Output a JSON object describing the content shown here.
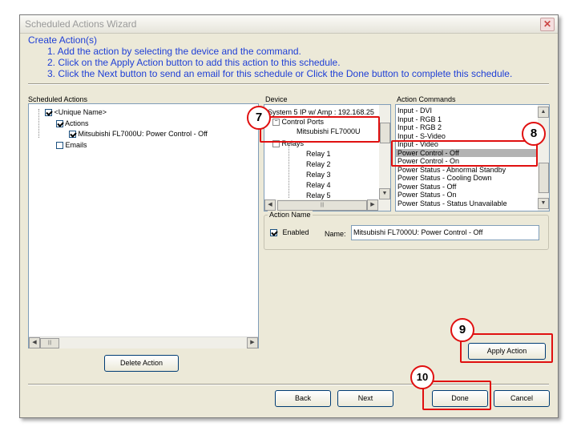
{
  "window": {
    "title": "Scheduled Actions Wizard",
    "close_glyph": "✕"
  },
  "instructions": {
    "heading": "Create Action(s)",
    "steps": [
      "1.   Add the action by selecting the device and the command.",
      "2.   Click on the Apply Action button to add this action to this schedule.",
      "3.   Click the Next button to send an email for this schedule or Click the Done button to complete this schedule."
    ]
  },
  "scheduled_actions": {
    "label": "Scheduled Actions",
    "tree": {
      "root": "<Unique Name>",
      "actions": "Actions",
      "action_item": "Mitsubishi FL7000U: Power Control - Off",
      "emails": "Emails"
    },
    "scroll_thumb_glyph": "|||",
    "delete_button": "Delete Action"
  },
  "device": {
    "label": "Device",
    "items": {
      "system": "System 5 IP w/ Amp : 192.168.25",
      "control_ports": "Control Ports",
      "mitsubishi": "Mitsubishi FL7000U",
      "relays": "Relays",
      "relay_list": [
        "Relay 1",
        "Relay 2",
        "Relay 3",
        "Relay 4",
        "Relay 5"
      ]
    },
    "scroll_thumb_glyph": "|||"
  },
  "action_commands": {
    "label": "Action Commands",
    "items": [
      "Input - DVI",
      "Input - RGB 1",
      "Input - RGB 2",
      "Input - S-Video",
      "Input - Video",
      "Power Control - Off",
      "Power Control - On",
      "Power Status - Abnormal Standby",
      "Power Status - Cooling Down",
      "Power Status - Off",
      "Power Status - On",
      "Power Status - Status Unavailable"
    ],
    "selected": "Power Control - Off"
  },
  "action_name": {
    "group_label": "Action Name",
    "enabled_label": "Enabled",
    "enabled": true,
    "name_label": "Name:",
    "name_value": "Mitsubishi FL7000U: Power Control - Off"
  },
  "buttons": {
    "apply": "Apply Action",
    "back": "Back",
    "next": "Next",
    "done": "Done",
    "cancel": "Cancel"
  },
  "callouts": {
    "step7": "7",
    "step8": "8",
    "step9": "9",
    "step10": "10"
  },
  "colors": {
    "instruction_text": "#1f3fd6",
    "callout_red": "#e01010",
    "selection": "#b3b3b3"
  }
}
